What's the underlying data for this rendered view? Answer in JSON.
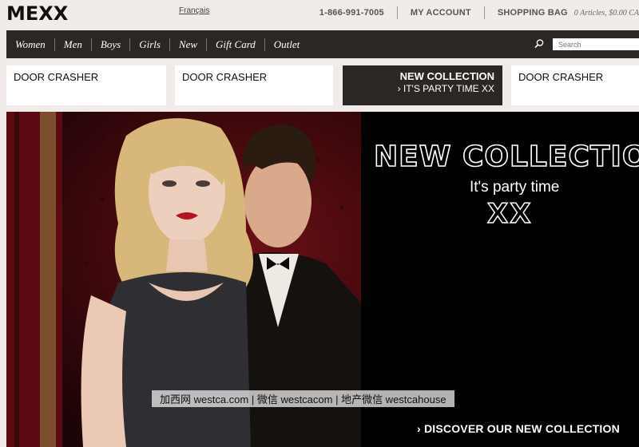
{
  "header": {
    "logo": "MEXX",
    "language_link": "Français",
    "phone": "1-866-991-7005",
    "my_account": "MY ACCOUNT",
    "shopping_bag": "SHOPPING BAG",
    "bag_info": "0 Articles, $0.00 CA"
  },
  "nav": {
    "items": [
      "Women",
      "Men",
      "Boys",
      "Girls",
      "New",
      "Gift Card",
      "Outlet"
    ],
    "search_placeholder": "Search"
  },
  "promos": {
    "tile1": "DOOR CRASHER",
    "tile2": "DOOR CRASHER",
    "tile3_title": "NEW COLLECTION",
    "tile3_sub": "› IT'S PARTY TIME XX",
    "tile4": "DOOR CRASHER"
  },
  "hero": {
    "title": "NEW COLLECTION",
    "subtitle": "It's party time",
    "xx": "XX",
    "cta": "› DISCOVER OUR NEW COLLECTION",
    "watermark": "加西网 westca.com | 微信 westcacom | 地产微信 westcahouse"
  },
  "colors": {
    "nav_bg": "#2b2725",
    "page_bg": "#f1ecea",
    "hero_bg": "#000000"
  }
}
